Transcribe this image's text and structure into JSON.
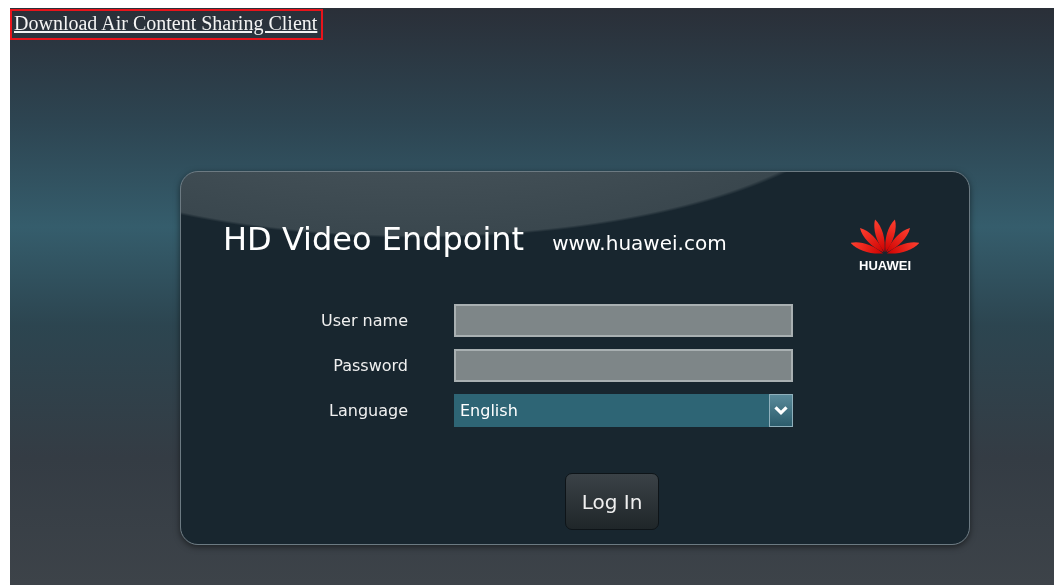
{
  "top_link": {
    "label": "Download Air Content Sharing Client",
    "highlighted": true
  },
  "login_card": {
    "title": "HD Video Endpoint",
    "website": "www.huawei.com",
    "logo_text": "HUAWEI",
    "fields": [
      {
        "kind": "text",
        "label": "User name"
      },
      {
        "kind": "password",
        "label": "Password"
      },
      {
        "kind": "select",
        "label": "Language",
        "value": "English"
      }
    ],
    "button": "Log In"
  }
}
